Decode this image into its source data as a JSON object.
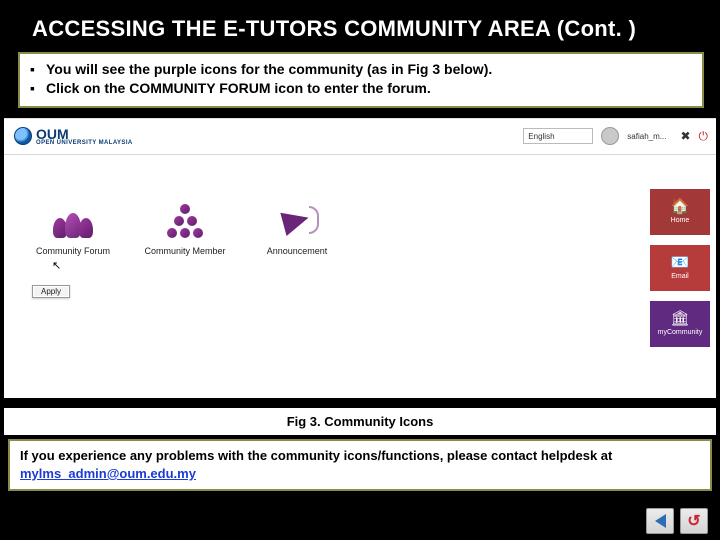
{
  "slide": {
    "title": "ACCESSING THE E-TUTORS COMMUNITY AREA (Cont. )",
    "instructions": [
      "You will see the purple icons for the community (as in Fig 3 below).",
      "Click on the COMMUNITY FORUM icon to enter the forum."
    ],
    "caption": "Fig 3. Community Icons",
    "helpdesk_text": "If you experience any problems with the community icons/functions, please contact helpdesk at ",
    "helpdesk_email": "mylms_admin@oum.edu.my"
  },
  "screenshot": {
    "brand": {
      "name": "OUM",
      "sub": "OPEN UNIVERSITY MALAYSIA"
    },
    "language": "English",
    "username": "safiah_m...",
    "tiles": [
      {
        "label": "Community Forum",
        "icon": "people-icon"
      },
      {
        "label": "Community Member",
        "icon": "members-icon"
      },
      {
        "label": "Announcement",
        "icon": "megaphone-icon"
      }
    ],
    "small_button": "Apply",
    "right_nav": [
      {
        "label": "Home",
        "icon": "home-icon",
        "cls": "r-red-a"
      },
      {
        "label": "Email",
        "icon": "envelope-icon",
        "cls": "r-red-b"
      },
      {
        "label": "myCommunity",
        "icon": "campus-icon",
        "cls": "r-purple"
      }
    ]
  },
  "nav": {
    "back": "Back",
    "home": "Home"
  }
}
